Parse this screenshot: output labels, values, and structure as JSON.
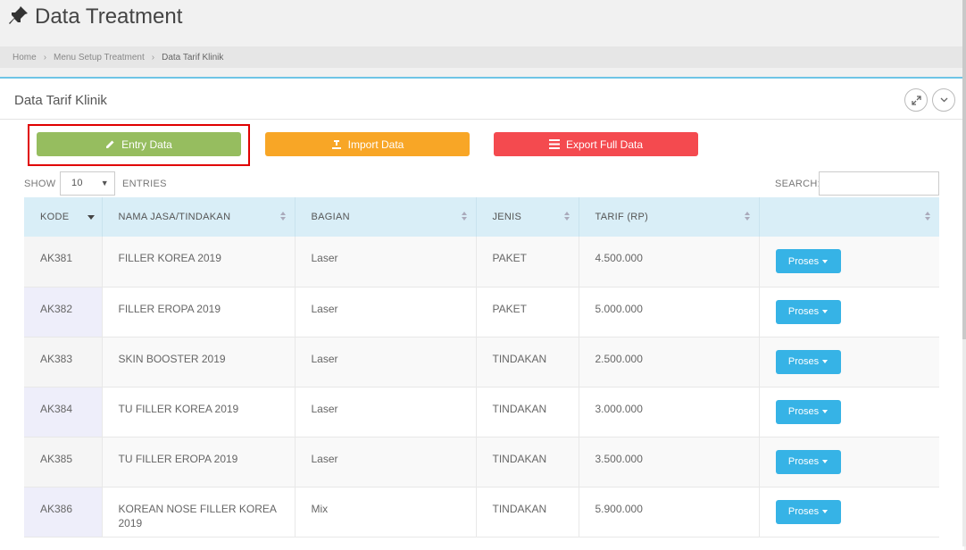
{
  "header": {
    "title": "Data Treatment"
  },
  "breadcrumb": {
    "items": [
      "Home",
      "Menu Setup Treatment",
      "Data Tarif Klinik"
    ]
  },
  "panel": {
    "title": "Data Tarif Klinik"
  },
  "toolbar": {
    "entry_label": "Entry Data",
    "import_label": "Import Data",
    "export_label": "Export Full Data"
  },
  "table_controls": {
    "show_label": "SHOW",
    "page_size": "10",
    "entries_label": "ENTRIES",
    "search_label": "SEARCH:"
  },
  "table": {
    "columns": [
      "KODE",
      "NAMA JASA/TINDAKAN",
      "BAGIAN",
      "JENIS",
      "TARIF (RP)",
      ""
    ],
    "action_label": "Proses",
    "rows": [
      {
        "kode": "AK381",
        "nama": "FILLER KOREA 2019",
        "bagian": "Laser",
        "jenis": "PAKET",
        "tarif": "4.500.000"
      },
      {
        "kode": "AK382",
        "nama": "FILLER EROPA 2019",
        "bagian": "Laser",
        "jenis": "PAKET",
        "tarif": "5.000.000"
      },
      {
        "kode": "AK383",
        "nama": "SKIN BOOSTER 2019",
        "bagian": "Laser",
        "jenis": "TINDAKAN",
        "tarif": "2.500.000"
      },
      {
        "kode": "AK384",
        "nama": "TU FILLER KOREA 2019",
        "bagian": "Laser",
        "jenis": "TINDAKAN",
        "tarif": "3.000.000"
      },
      {
        "kode": "AK385",
        "nama": "TU FILLER EROPA 2019",
        "bagian": "Laser",
        "jenis": "TINDAKAN",
        "tarif": "3.500.000"
      },
      {
        "kode": "AK386",
        "nama": "KOREAN NOSE FILLER KOREA 2019",
        "bagian": "Mix",
        "jenis": "TINDAKAN",
        "tarif": "5.900.000"
      }
    ]
  },
  "colors": {
    "entry": "#96bd5f",
    "import": "#f8a626",
    "export": "#f44a4f",
    "proses": "#36b3e6",
    "header_bg": "#d9eef7",
    "highlight": "#e00000"
  },
  "icons": {
    "title": "pushpin-icon",
    "entry": "pencil-icon",
    "import": "upload-icon",
    "export": "list-icon",
    "expand": "expand-icon",
    "collapse": "chevron-down-icon"
  }
}
